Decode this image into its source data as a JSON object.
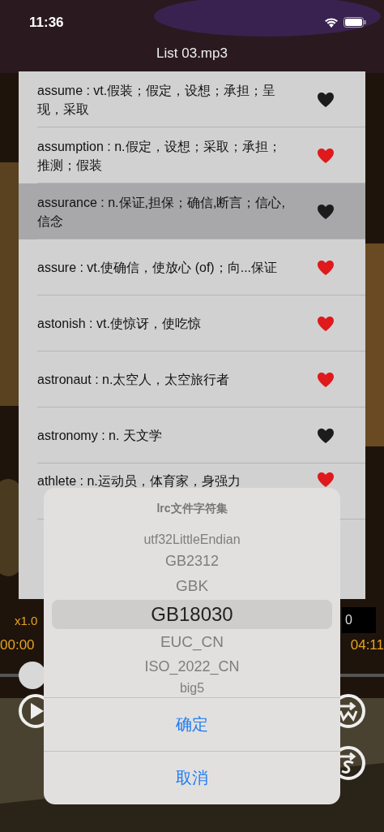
{
  "status_bar": {
    "time": "11:36"
  },
  "title": "List 03.mp3",
  "rows": [
    {
      "text": "assume : vt.假装；假定，设想；承担；呈现，采取",
      "favorite": false,
      "selected": false
    },
    {
      "text": "assumption : n.假定，设想；采取；承担；推测；假装",
      "favorite": true,
      "selected": false
    },
    {
      "text": "assurance : n.保证,担保；确信,断言；信心,信念",
      "favorite": false,
      "selected": true
    },
    {
      "text": "assure : vt.使确信，使放心 (of)；向...保证",
      "favorite": true,
      "selected": false
    },
    {
      "text": "astonish : vt.使惊讶，使吃惊",
      "favorite": true,
      "selected": false
    },
    {
      "text": "astronaut : n.太空人，太空旅行者",
      "favorite": true,
      "selected": false
    },
    {
      "text": "astronomy : n.  天文学",
      "favorite": false,
      "selected": false
    },
    {
      "text": "athlete : n.运动员，体育家，身强力",
      "favorite": true,
      "selected": false
    }
  ],
  "player": {
    "speed": "x1.0",
    "current_time": "00:00",
    "total_time": "04:11",
    "counter": "0",
    "progress": {
      "level": 0
    }
  },
  "dialog": {
    "title": "lrc文件字符集",
    "options": [
      {
        "label": "utf32LittleEndian",
        "selected": false
      },
      {
        "label": "GB2312",
        "selected": false
      },
      {
        "label": "GBK",
        "selected": false
      },
      {
        "label": "GB18030",
        "selected": true
      },
      {
        "label": "EUC_CN",
        "selected": false
      },
      {
        "label": "ISO_2022_CN",
        "selected": false
      },
      {
        "label": "big5",
        "selected": false
      }
    ],
    "buttons": [
      "确定",
      "取消"
    ]
  }
}
